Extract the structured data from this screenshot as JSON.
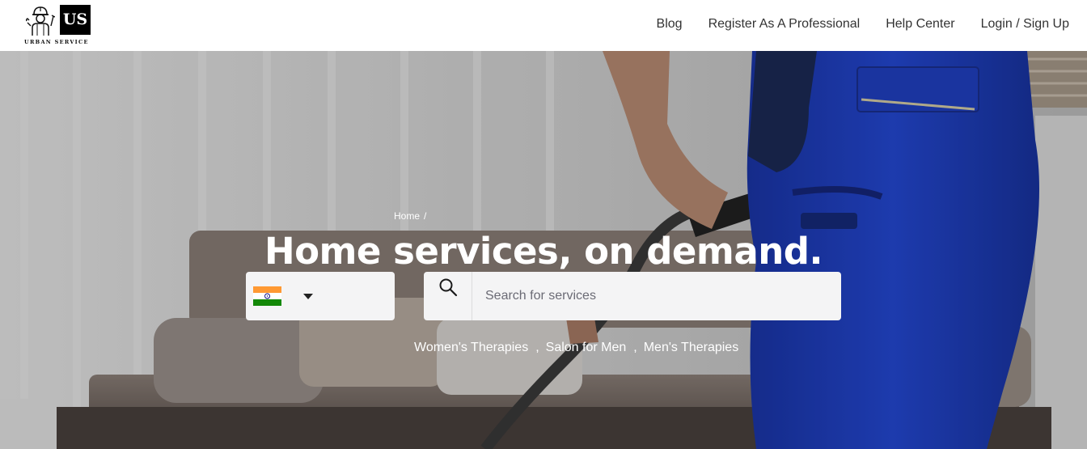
{
  "brand": {
    "logo_initials": "US",
    "logo_name": "URBAN SERVICE"
  },
  "nav": {
    "items": [
      {
        "label": "Blog"
      },
      {
        "label": "Register As A Professional"
      },
      {
        "label": "Help Center"
      },
      {
        "label": "Login / Sign Up"
      }
    ]
  },
  "breadcrumb": {
    "home": "Home",
    "separator": "/"
  },
  "hero": {
    "title": "Home services, on demand."
  },
  "country_select": {
    "selected_flag": "india-flag-icon"
  },
  "search": {
    "placeholder": "Search for services",
    "value": ""
  },
  "popular_services": {
    "items": [
      "Women's Therapies",
      "Salon for Men",
      "Men's Therapies"
    ],
    "separator": ","
  },
  "colors": {
    "header_bg": "#ffffff",
    "nav_text": "#333333",
    "hero_text": "#ffffff",
    "input_bg": "#f4f4f5",
    "uniform_blue": "#1f3fc4"
  }
}
